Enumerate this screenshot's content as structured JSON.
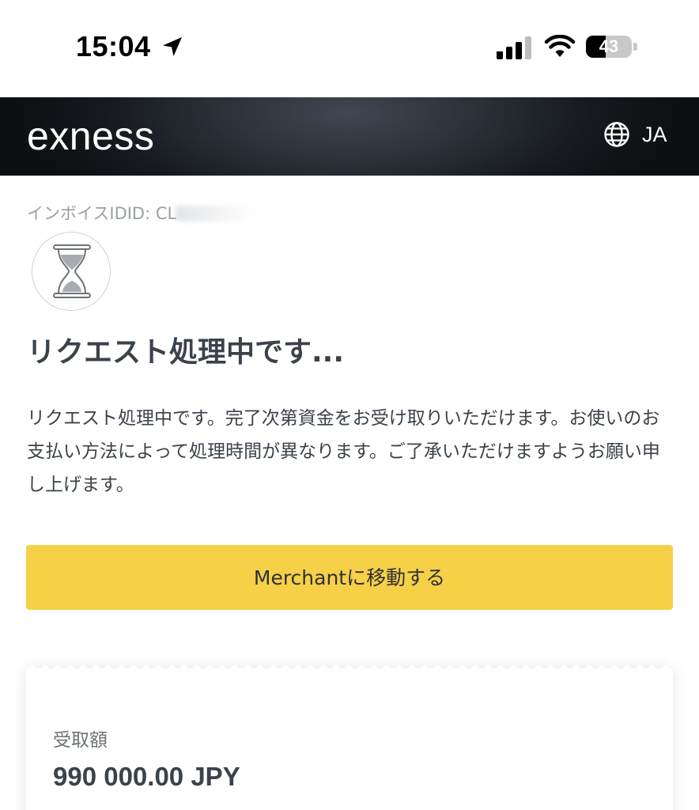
{
  "status_bar": {
    "time": "15:04",
    "battery_level": "43",
    "battery_fraction": 0.43
  },
  "header": {
    "logo_text": "exness",
    "language": "JA"
  },
  "invoice": {
    "label": "インボイスID",
    "id_visible": "ID: CL"
  },
  "main": {
    "title": "リクエスト処理中です...",
    "description": "リクエスト処理中です。完了次第資金をお受け取りいただけます。お使いのお支払い方法によって処理時間が異なります。ご了承いただけますようお願い申し上げます。",
    "merchant_button_label": "Merchantに移動する"
  },
  "receipt": {
    "received_label": "受取額",
    "received_amount": "990 000.00 JPY"
  },
  "colors": {
    "accent_yellow": "#f6d047",
    "text_dark": "#3c424b",
    "header_dark": "#15181c"
  },
  "icons": {
    "location": "location-arrow-icon",
    "signal": "cellular-signal-icon",
    "wifi": "wifi-icon",
    "battery": "battery-icon",
    "globe": "globe-icon",
    "hourglass": "hourglass-icon"
  }
}
